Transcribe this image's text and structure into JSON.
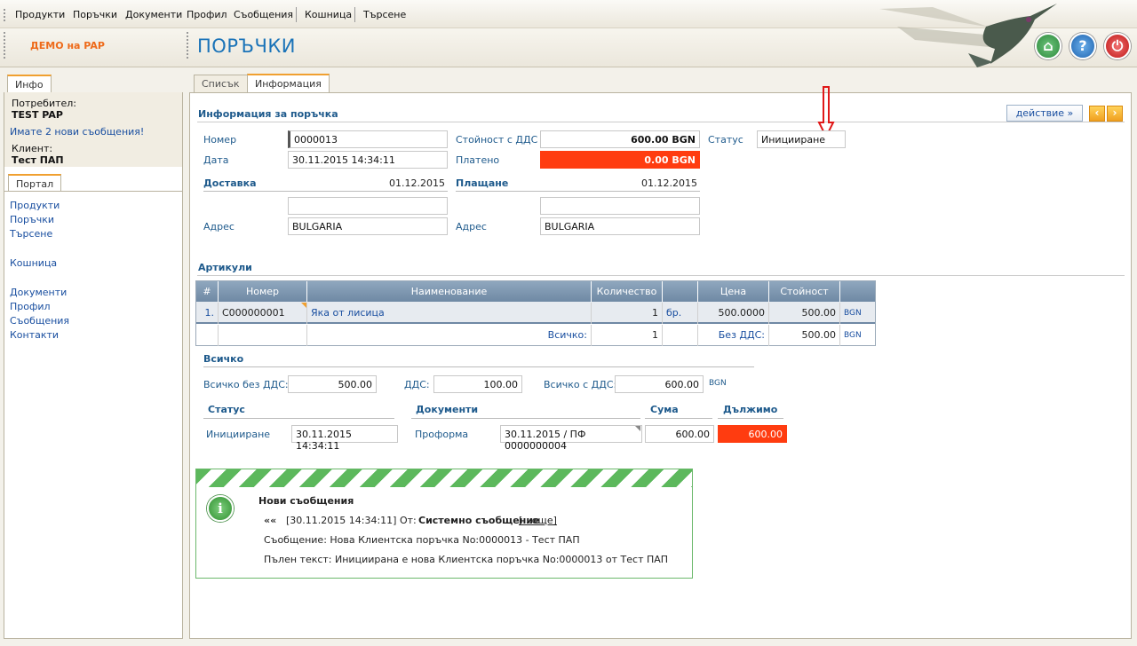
{
  "menu": {
    "items": [
      "Продукти",
      "Поръчки",
      "Документи",
      "Профил",
      "Съобщения",
      "Кошница",
      "Търсене"
    ]
  },
  "header": {
    "company": "ДЕМО на PAP",
    "title": "ПОРЪЧКИ"
  },
  "left": {
    "tab_info": "Инфо",
    "user_label": "Потребител:",
    "user_name": "TEST PAP",
    "messages_link": "Имате 2 нови съобщения!",
    "client_label": "Клиент:",
    "client_name": "Тест ПАП",
    "tab_portal": "Портал",
    "portal_links": [
      "Продукти",
      "Поръчки",
      "Търсене",
      "Кошница",
      "Документи",
      "Профил",
      "Съобщения",
      "Контакти"
    ]
  },
  "main": {
    "tab_list": "Списък",
    "tab_info": "Информация",
    "section_title": "Информация за поръчка",
    "action_button": "действие »",
    "number_label": "Номер",
    "number_value": "0000013",
    "date_label": "Дата",
    "date_value": "30.11.2015 14:34:11",
    "total_vat_label": "Стойност с ДДС",
    "total_vat_value": "600.00 BGN",
    "paid_label": "Платено",
    "paid_value": "0.00 BGN",
    "status_label": "Статус",
    "status_value": "Иницииране",
    "delivery_label": "Доставка",
    "delivery_date": "01.12.2015",
    "payment_label": "Плащане",
    "payment_date": "01.12.2015",
    "address_label": "Адрес",
    "delivery_address": "BULGARIA",
    "payment_address": "BULGARIA",
    "articles_title": "Артикули",
    "grid_headers": [
      "#",
      "Номер",
      "Наименование",
      "Количество",
      "",
      "Цена",
      "Стойност",
      ""
    ],
    "row": {
      "idx": "1.",
      "code": "C000000001",
      "name": "Яка от лисица",
      "qty": "1",
      "unit": "бр.",
      "price": "500.0000",
      "value": "500.00",
      "cur": "BGN"
    },
    "total_row": {
      "label": "Всичко:",
      "qty": "1",
      "novat_label": "Без ДДС:",
      "value": "500.00",
      "cur": "BGN"
    },
    "totals_title": "Всичко",
    "novat_label": "Всичко без ДДС:",
    "novat_value": "500.00",
    "vat_label": "ДДС:",
    "vat_value": "100.00",
    "withvat_label": "Всичко с ДДС:",
    "withvat_value": "600.00",
    "currency": "BGN",
    "status_col": "Статус",
    "docs_col": "Документи",
    "sum_col": "Сума",
    "due_col": "Дължимо",
    "st_value": "Иницииране",
    "st_date": "30.11.2015 14:34:11",
    "doc_type": "Проформа",
    "doc_value": "30.11.2015 / ПФ 0000000004",
    "sum_value": "600.00",
    "due_value": "600.00"
  },
  "message": {
    "title": "Нови съобщения",
    "nav": "««",
    "line1_prefix": "[30.11.2015 14:34:11] От: ",
    "line1_sender": "Системно съобщение",
    "line1_more": "[...още]",
    "line2": "Съобщение: Нова Клиентска поръчка No:0000013 - Тест ПАП",
    "line3": "Пълен текст: Инициирана е нова Клиентска поръчка No:0000013 от Тест ПАП"
  },
  "colors": {
    "accent": "#1a73b8",
    "alert_red": "#ff3c10",
    "orange": "#ee6a1a"
  }
}
